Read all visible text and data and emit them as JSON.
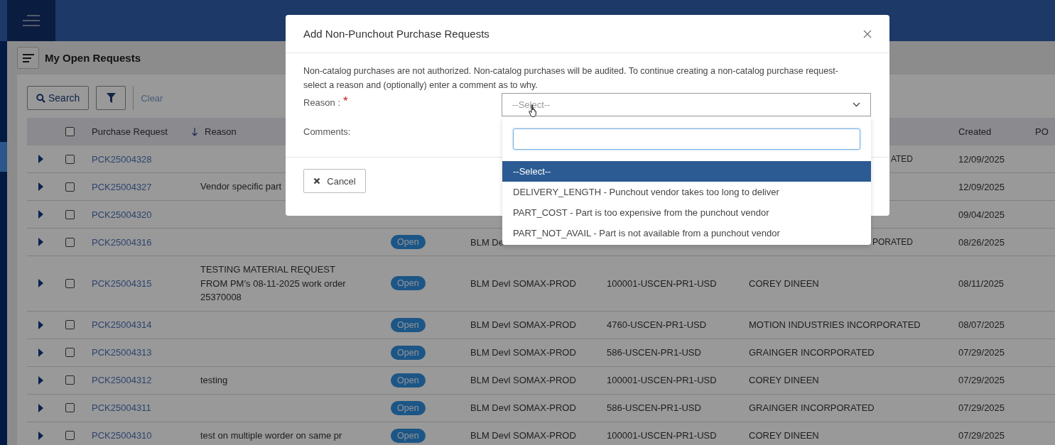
{
  "page": {
    "title": "My Open Requests"
  },
  "toolbar": {
    "search_button": "Search",
    "clear_link": "Clear"
  },
  "table": {
    "header": {
      "all_checked": false,
      "purchase_request": "Purchase Request",
      "reason": "Reason",
      "reason_sorted": true,
      "created": "Created",
      "column_10": "PO"
    },
    "rows": [
      {
        "id": "PCK25004328",
        "checked": false,
        "vendor": "ATED",
        "vendor_partial": true,
        "created": "12/09/2025"
      },
      {
        "id": "PCK25004327",
        "checked": false,
        "reason": "Vendor specific part",
        "created": "12/09/2025"
      },
      {
        "id": "PCK25004320",
        "checked": false,
        "created": "09/04/2025"
      },
      {
        "id": "PCK25004316",
        "checked": false,
        "status": "Open",
        "site": "BLM De",
        "vendor": "PORATED",
        "vendor_partial": true,
        "created": "08/26/2025"
      },
      {
        "id": "PCK25004315",
        "checked": false,
        "reason": "TESTING MATERIAL REQUEST FROM PM’s 08-11-2025 work order 25370008",
        "status": "Open",
        "site": "BLM Devl SOMAX-PROD",
        "account": "100001-USCEN-PR1-USD",
        "vendor": "COREY DINEEN",
        "created": "08/11/2025"
      },
      {
        "id": "PCK25004314",
        "checked": false,
        "status": "Open",
        "site": "BLM Devl SOMAX-PROD",
        "account": "4760-USCEN-PR1-USD",
        "vendor": "MOTION INDUSTRIES INCORPORATED",
        "created": "08/07/2025"
      },
      {
        "id": "PCK25004313",
        "checked": false,
        "status": "Open",
        "site": "BLM Devl SOMAX-PROD",
        "account": "586-USCEN-PR1-USD",
        "vendor": "GRAINGER INCORPORATED",
        "created": "07/29/2025"
      },
      {
        "id": "PCK25004312",
        "checked": false,
        "reason": "testing",
        "status": "Open",
        "site": "BLM Devl SOMAX-PROD",
        "account": "100001-USCEN-PR1-USD",
        "vendor": "COREY DINEEN",
        "created": "07/29/2025"
      },
      {
        "id": "PCK25004311",
        "checked": false,
        "status": "Open",
        "site": "BLM Devl SOMAX-PROD",
        "account": "586-USCEN-PR1-USD",
        "vendor": "GRAINGER INCORPORATED",
        "created": "07/29/2025"
      },
      {
        "id": "PCK25004310",
        "checked": false,
        "reason": "test on multiple worder on same pr",
        "status": "Open",
        "site": "BLM Devl SOMAX-PROD",
        "account": "100001-USCEN-PR1-USD",
        "vendor": "COREY DINEEN",
        "created": "07/29/2025"
      }
    ]
  },
  "dialog": {
    "title": "Add Non-Punchout Purchase Requests",
    "message": "Non-catalog purchases are not authorized. Non-catalog purchases will be audited. To continue creating a non-catalog purchase request- select a reason and (optionally) enter a comment as to why.",
    "reason_label": "Reason :",
    "required_mark": "*",
    "reason_select": {
      "placeholder": "--Select--",
      "expanded": true
    },
    "comments_label": "Comments:",
    "cancel_button": "Cancel",
    "options": [
      {
        "label": "--Select--",
        "selected": true
      },
      {
        "label": "DELIVERY_LENGTH - Punchout vendor takes too long to deliver",
        "selected": false
      },
      {
        "label": "PART_COST - Part is too expensive from the punchout vendor",
        "selected": false
      },
      {
        "label": "PART_NOT_AVAIL - Part is not available from a punchout vendor",
        "selected": false
      }
    ]
  }
}
